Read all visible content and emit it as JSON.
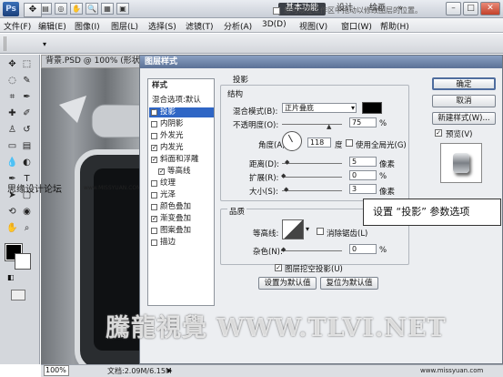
{
  "app": {
    "logo": "Ps",
    "workspace_buttons": [
      "基本功能",
      "设计",
      "绘画"
    ],
    "more": "»",
    "window_buttons": [
      "–",
      "□",
      "✕"
    ]
  },
  "menubar": [
    "文件(F)",
    "编辑(E)",
    "图像(I)",
    "图层(L)",
    "选择(S)",
    "滤镜(T)",
    "分析(A)",
    "3D(D)",
    "视图(V)",
    "窗口(W)",
    "帮助(H)"
  ],
  "options_bar": {
    "hint": "您可以在工作区中拖动以修改图层的位置。"
  },
  "document": {
    "tab_title": "背景.PSD @ 100% (形状",
    "zoom": "100%",
    "doc_size": "文档:2.09M/6.15M"
  },
  "dialog": {
    "title": "图层样式",
    "styles_header": "样式",
    "blend_default": "混合选项:默认",
    "styles": [
      {
        "label": "投影",
        "checked": true,
        "selected": true
      },
      {
        "label": "内阴影",
        "checked": false
      },
      {
        "label": "外发光",
        "checked": false
      },
      {
        "label": "内发光",
        "checked": true
      },
      {
        "label": "斜面和浮雕",
        "checked": true
      },
      {
        "label": "等高线",
        "checked": true
      },
      {
        "label": "纹理",
        "checked": false
      },
      {
        "label": "光泽",
        "checked": false
      },
      {
        "label": "颜色叠加",
        "checked": false
      },
      {
        "label": "渐变叠加",
        "checked": true
      },
      {
        "label": "图案叠加",
        "checked": false
      },
      {
        "label": "描边",
        "checked": false
      }
    ],
    "section_title": "投影",
    "structure_title": "结构",
    "blend_mode_label": "混合模式(B):",
    "blend_mode_value": "正片叠底",
    "opacity_label": "不透明度(O):",
    "opacity_value": "75",
    "percent": "%",
    "angle_label": "角度(A):",
    "angle_value": "118",
    "degree": "度",
    "global_light_label": "使用全局光(G)",
    "distance_label": "距离(D):",
    "distance_value": "5",
    "pixels": "像素",
    "spread_label": "扩展(R):",
    "spread_value": "0",
    "size_label": "大小(S):",
    "size_value": "3",
    "quality_title": "品质",
    "contour_label": "等高线:",
    "antialias_label": "消除锯齿(L)",
    "noise_label": "杂色(N):",
    "noise_value": "0",
    "knockout_label": "图层挖空投影(U)",
    "make_default": "设置为默认值",
    "reset_default": "复位为默认值",
    "ok": "确定",
    "cancel": "取消",
    "new_style": "新建样式(W)...",
    "preview_label": "预览(V)"
  },
  "callout": "设置 “投影” 参数选项",
  "overlay": {
    "site": "思缘设计论坛",
    "site_url": "www.MISSYUAN.COM",
    "watermark": "騰龍視覺 WWW.TLVI.NET",
    "missyuan": "www.missyuan.com"
  },
  "colors": {
    "accent": "#2f66c5",
    "title_bar": "#5b7196",
    "shadow_color": "#000000"
  }
}
